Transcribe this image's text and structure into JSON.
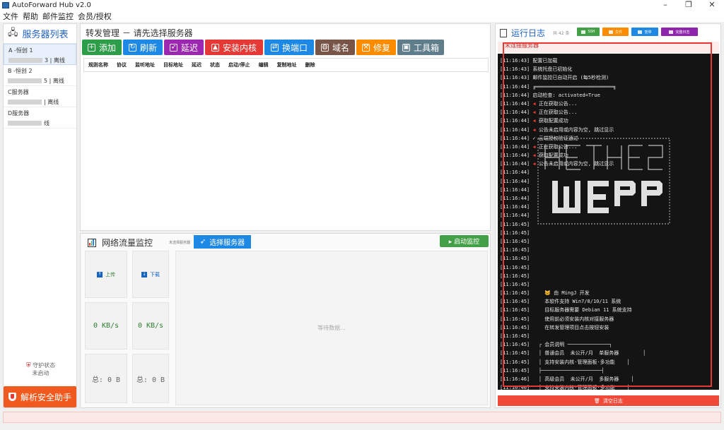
{
  "window": {
    "title": "AutoForward Hub v2.0",
    "minimize": "–",
    "maximize": "❐",
    "close": "✕"
  },
  "menu": [
    "文件",
    "帮助",
    "邮件监控",
    "会员/授权"
  ],
  "sidebar": {
    "title": "服务器列表",
    "servers": [
      {
        "name": "A -恒创 1",
        "status": "3 | 离线"
      },
      {
        "name": "B -恒创 2",
        "status": "5 | 离线"
      },
      {
        "name": "C服务器",
        "status": "| 离线"
      },
      {
        "name": "D服务器",
        "status": "线"
      }
    ],
    "guard_label": "守护状态",
    "guard_status": "未启动",
    "assistant_button": "解析安全助手"
  },
  "forward": {
    "title": "转发管理 － 请先选择服务器",
    "toolbar": [
      {
        "label": "添加",
        "icon": "plus-icon",
        "color": "#2e9d4a"
      },
      {
        "label": "刷新",
        "icon": "refresh-icon",
        "color": "#1e88e5"
      },
      {
        "label": "延迟",
        "icon": "rocket-icon",
        "color": "#9c27b0"
      },
      {
        "label": "安装内核",
        "icon": "install-icon",
        "color": "#e53935"
      },
      {
        "label": "换端口",
        "icon": "swap-icon",
        "color": "#1e88e5"
      },
      {
        "label": "域名",
        "icon": "globe-icon",
        "color": "#795548"
      },
      {
        "label": "修复",
        "icon": "wrench-icon",
        "color": "#fb8c00"
      },
      {
        "label": "工具箱",
        "icon": "toolbox-icon",
        "color": "#607d8b"
      }
    ],
    "columns": [
      "规则名称",
      "协议",
      "监听地址",
      "目标地址",
      "延迟",
      "状态",
      "启动/停止",
      "编辑",
      "复制地址",
      "删除"
    ]
  },
  "monitor": {
    "title": "网络流量监控",
    "status": "未选择服务器",
    "select_button": "选择服务器",
    "start_button": "▸ 启动监控",
    "upload_label": "上传",
    "download_label": "下载",
    "upload_speed": "0 KB/s",
    "download_speed": "0 KB/s",
    "upload_total": "总: 0 B",
    "download_total": "总: 0 B",
    "chart_placeholder": "等待数据..."
  },
  "log": {
    "title": "运行日志",
    "count": "共 42 条",
    "buttons": [
      {
        "label": "SSH",
        "color": "#43a047"
      },
      {
        "label": "文件",
        "color": "#fb8c00"
      },
      {
        "label": "暂停",
        "color": "#1e88e5"
      },
      {
        "label": "完整日志",
        "color": "#8e24aa"
      }
    ],
    "status": "未连接服务器",
    "clear_button": "清空日志",
    "lines": [
      {
        "ts": "[11:16:43]",
        "flag": "",
        "text": "配置已加载"
      },
      {
        "ts": "[11:16:43]",
        "flag": "",
        "text": "系统托盘已初始化"
      },
      {
        "ts": "[11:16:43]",
        "flag": "",
        "text": "邮件监控已自动开启 (每5秒检测)"
      },
      {
        "ts": "[11:16:44]",
        "flag": "",
        "text": "╔══════════════════════════╗"
      },
      {
        "ts": "[11:16:44]",
        "flag": "",
        "text": "启动检查: activated=True"
      },
      {
        "ts": "[11:16:44]",
        "flag": "◀",
        "text": "正在获取公告..."
      },
      {
        "ts": "[11:16:44]",
        "flag": "◀",
        "text": "正在获取公告..."
      },
      {
        "ts": "[11:16:44]",
        "flag": "◀",
        "text": "获取配置成功"
      },
      {
        "ts": "[11:16:44]",
        "flag": "◀",
        "text": "公告未启用或内容为空, 跳过显示"
      },
      {
        "ts": "[11:16:44]",
        "flag": "",
        "text": "✓ 云端授权验证通过"
      },
      {
        "ts": "[11:16:44]",
        "flag": "◀",
        "text": "正在获取公告..."
      },
      {
        "ts": "[11:16:44]",
        "flag": "◀",
        "text": "获取配置成功"
      },
      {
        "ts": "[11:16:44]",
        "flag": "◀",
        "text": "公告未启用或内容为空, 跳过显示"
      },
      {
        "ts": "[11:16:44]",
        "flag": "",
        "text": ""
      },
      {
        "ts": "[11:16:44]",
        "flag": "",
        "text": ""
      },
      {
        "ts": "[11:16:44]",
        "flag": "",
        "text": ""
      },
      {
        "ts": "[11:16:44]",
        "flag": "",
        "text": ""
      },
      {
        "ts": "[11:16:44]",
        "flag": "",
        "text": ""
      },
      {
        "ts": "[11:16:44]",
        "flag": "",
        "text": ""
      },
      {
        "ts": "[11:16:45]",
        "flag": "",
        "text": ""
      },
      {
        "ts": "[11:16:45]",
        "flag": "",
        "text": ""
      },
      {
        "ts": "[11:16:45]",
        "flag": "",
        "text": ""
      },
      {
        "ts": "[11:16:45]",
        "flag": "",
        "text": ""
      },
      {
        "ts": "[11:16:45]",
        "flag": "",
        "text": ""
      },
      {
        "ts": "[11:16:45]",
        "flag": "",
        "text": ""
      },
      {
        "ts": "[11:16:45]",
        "flag": "",
        "text": ""
      },
      {
        "ts": "[11:16:45]",
        "flag": "",
        "text": ""
      },
      {
        "ts": "[11:16:45]",
        "flag": "",
        "text": "    🐱 由 MingJ 开发"
      },
      {
        "ts": "[11:16:45]",
        "flag": "",
        "text": "    本软件支持 Win7/8/10/11 系统"
      },
      {
        "ts": "[11:16:45]",
        "flag": "",
        "text": "    目标服务器需要 Debian 11 系统支持"
      },
      {
        "ts": "[11:16:45]",
        "flag": "",
        "text": "    使用前必须安装内核对接服务器"
      },
      {
        "ts": "[11:16:45]",
        "flag": "",
        "text": "    在转发管理项目点击按钮安装"
      },
      {
        "ts": "[11:16:45]",
        "flag": "",
        "text": ""
      },
      {
        "ts": "[11:16:45]",
        "flag": "",
        "text": "  ┌ 会员说明 ──────────────┐"
      },
      {
        "ts": "[11:16:45]",
        "flag": "",
        "text": "  │ 普通会员  未公开/月  单服务器        │"
      },
      {
        "ts": "[11:16:45]",
        "flag": "",
        "text": "  │ 支持安装内核·管理面板·多功能    │"
      },
      {
        "ts": "[11:16:45]",
        "flag": "",
        "text": "  ├────────────────────┤"
      },
      {
        "ts": "[11:16:46]",
        "flag": "",
        "text": "  │ 高级会员  未公开/月  多服务器    │"
      },
      {
        "ts": "[11:16:46]",
        "flag": "",
        "text": "  │ 支持安装内核·管理面板·多功能    │"
      },
      {
        "ts": "[11:16:46]",
        "flag": "",
        "text": "  └────────────────────┘"
      },
      {
        "ts": "[11:16:46]",
        "flag": "",
        "text": ""
      },
      {
        "ts": "[11:16:46]",
        "flag": "",
        "text": ""
      }
    ]
  }
}
